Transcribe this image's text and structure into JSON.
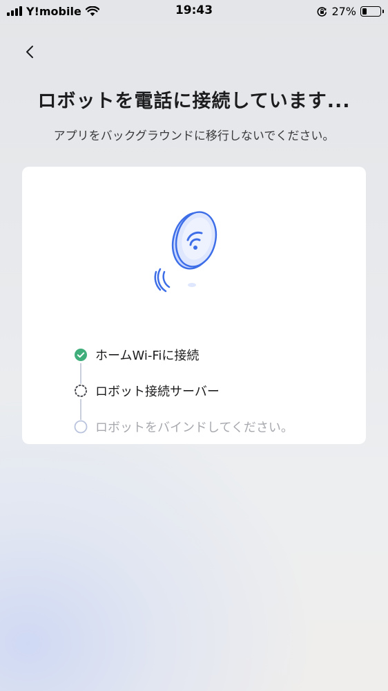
{
  "status_bar": {
    "carrier": "Y!mobile",
    "time": "19:43",
    "battery_percent": "27%",
    "battery_level": 0.27,
    "icons": [
      "signal-icon",
      "wifi-icon",
      "orientation-lock-icon",
      "battery-icon"
    ]
  },
  "header": {
    "back_icon": "chevron-left-icon",
    "title": "ロボットを電話に接続しています...",
    "subtitle": "アプリをバックグラウンドに移行しないでください。"
  },
  "card": {
    "illustration": "robot-wifi-connect-icon",
    "steps": [
      {
        "label": "ホームWi-Fiに接続",
        "status": "done"
      },
      {
        "label": "ロボット接続サーバー",
        "status": "in-progress"
      },
      {
        "label": "ロボットをバインドしてください。",
        "status": "pending"
      }
    ]
  },
  "colors": {
    "accent_blue": "#3d6ee8",
    "done_green": "#3fae7a",
    "pending_gray": "#a7a9ae",
    "step_line": "#c9cfdc"
  }
}
